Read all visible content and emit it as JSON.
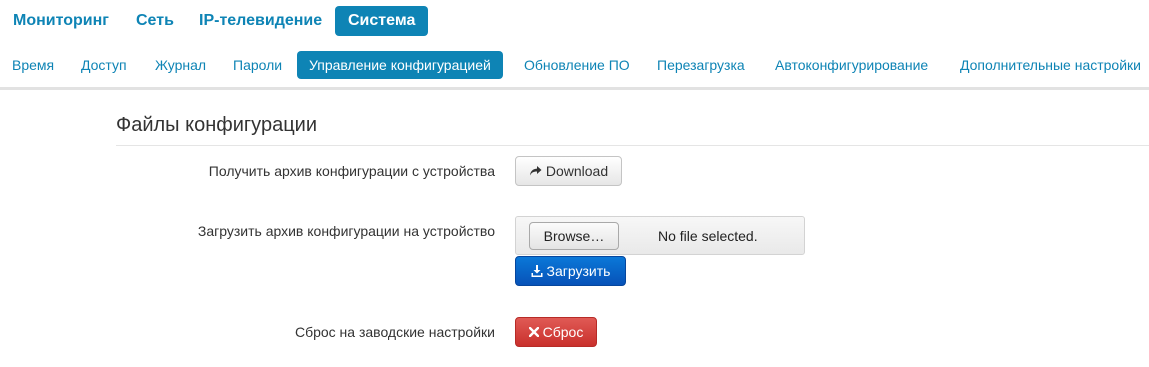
{
  "top_nav": {
    "items": [
      {
        "label": "Мониторинг",
        "active": false
      },
      {
        "label": "Сеть",
        "active": false
      },
      {
        "label": "IP-телевидение",
        "active": false
      },
      {
        "label": "Система",
        "active": true
      }
    ]
  },
  "sub_nav": {
    "items": [
      {
        "label": "Время",
        "active": false
      },
      {
        "label": "Доступ",
        "active": false
      },
      {
        "label": "Журнал",
        "active": false
      },
      {
        "label": "Пароли",
        "active": false
      },
      {
        "label": "Управление конфигурацией",
        "active": true
      },
      {
        "label": "Обновление ПО",
        "active": false
      },
      {
        "label": "Перезагрузка",
        "active": false
      },
      {
        "label": "Автоконфигурирование",
        "active": false
      },
      {
        "label": "Дополнительные настройки",
        "active": false
      }
    ]
  },
  "section": {
    "title": "Файлы конфигурации"
  },
  "rows": {
    "download": {
      "label": "Получить архив конфигурации с устройства",
      "button_label": "Download",
      "icon": "share-arrow-icon"
    },
    "upload": {
      "label": "Загрузить архив конфигурации на устройство",
      "browse_label": "Browse…",
      "file_status": "No file selected.",
      "button_label": "Загрузить",
      "icon": "download-tray-icon",
      "button_color": "#0752b8"
    },
    "reset": {
      "label": "Сброс на заводские настройки",
      "button_label": "Сброс",
      "icon": "x-icon",
      "button_color": "#c9302c"
    }
  },
  "colors": {
    "accent": "#0e84b5"
  }
}
